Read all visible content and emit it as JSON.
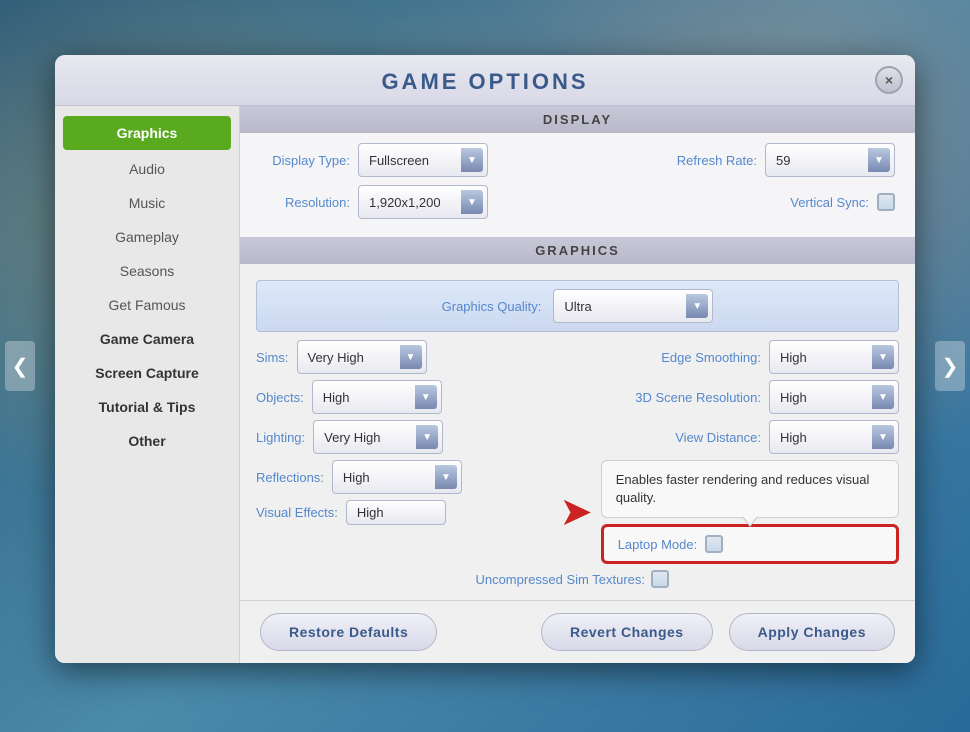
{
  "background": {
    "color": "#3a6b8a"
  },
  "dialog": {
    "title": "Game Options",
    "close_label": "×"
  },
  "sidebar": {
    "items": [
      {
        "id": "graphics",
        "label": "Graphics",
        "active": true
      },
      {
        "id": "audio",
        "label": "Audio",
        "active": false
      },
      {
        "id": "music",
        "label": "Music",
        "active": false
      },
      {
        "id": "gameplay",
        "label": "Gameplay",
        "active": false
      },
      {
        "id": "seasons",
        "label": "Seasons",
        "active": false
      },
      {
        "id": "get-famous",
        "label": "Get Famous",
        "active": false
      },
      {
        "id": "game-camera",
        "label": "Game Camera",
        "active": false
      },
      {
        "id": "screen-capture",
        "label": "Screen Capture",
        "active": false
      },
      {
        "id": "tutorial-tips",
        "label": "Tutorial & Tips",
        "active": false
      },
      {
        "id": "other",
        "label": "Other",
        "active": false
      }
    ]
  },
  "sections": {
    "display": {
      "header": "Display",
      "display_type_label": "Display Type:",
      "display_type_value": "Fullscreen",
      "refresh_rate_label": "Refresh Rate:",
      "refresh_rate_value": "59",
      "resolution_label": "Resolution:",
      "resolution_value": "1,920x1,200",
      "vertical_sync_label": "Vertical Sync:"
    },
    "graphics": {
      "header": "Graphics",
      "quality_label": "Graphics Quality:",
      "quality_value": "Ultra",
      "sims_label": "Sims:",
      "sims_value": "Very High",
      "edge_smoothing_label": "Edge Smoothing:",
      "edge_smoothing_value": "High",
      "objects_label": "Objects:",
      "objects_value": "High",
      "scene_res_label": "3D Scene Resolution:",
      "scene_res_value": "High",
      "lighting_label": "Lighting:",
      "lighting_value": "Very High",
      "view_distance_label": "View Distance:",
      "view_distance_value": "High",
      "reflections_label": "Reflections:",
      "reflections_value": "High",
      "uncompressed_label": "Uncompressed Sim Textures:",
      "visual_effects_label": "Visual Effects:",
      "visual_effects_value": "High",
      "laptop_mode_label": "Laptop Mode:",
      "tooltip_text": "Enables faster rendering and reduces visual quality."
    }
  },
  "footer": {
    "restore_defaults": "Restore Defaults",
    "revert_changes": "Revert Changes",
    "apply_changes": "Apply Changes"
  },
  "dropdown_arrow": "▼",
  "nav": {
    "left": "❮",
    "right": "❯"
  }
}
